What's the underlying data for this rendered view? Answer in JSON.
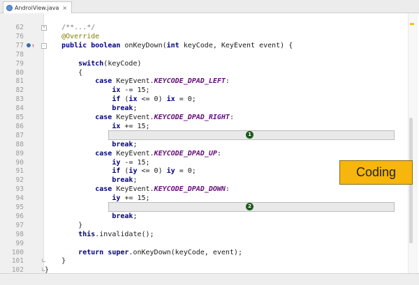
{
  "tab": {
    "title": "AndroiView.java",
    "close": "×"
  },
  "overlay": {
    "label": "Coding"
  },
  "badges": [
    "1",
    "2"
  ],
  "lines": [
    {
      "n": "62",
      "segs": [
        [
          "",
          "    "
        ],
        [
          "cmt",
          "/**...*/"
        ]
      ]
    },
    {
      "n": "76",
      "segs": [
        [
          "",
          "    "
        ],
        [
          "ann",
          "@Override"
        ]
      ]
    },
    {
      "n": "77",
      "segs": [
        [
          "",
          "    "
        ],
        [
          "kw",
          "public boolean"
        ],
        [
          "",
          " onKeyDown("
        ],
        [
          "kw",
          "int"
        ],
        [
          "",
          " keyCode, KeyEvent event) {"
        ]
      ]
    },
    {
      "n": "78",
      "segs": []
    },
    {
      "n": "79",
      "segs": [
        [
          "",
          "        "
        ],
        [
          "kw",
          "switch"
        ],
        [
          "",
          "(keyCode)"
        ]
      ]
    },
    {
      "n": "80",
      "segs": [
        [
          "",
          "        {"
        ]
      ]
    },
    {
      "n": "81",
      "segs": [
        [
          "",
          "            "
        ],
        [
          "kw",
          "case"
        ],
        [
          "",
          " KeyEvent."
        ],
        [
          "const",
          "KEYCODE_DPAD_LEFT"
        ],
        [
          "",
          ":"
        ]
      ]
    },
    {
      "n": "82",
      "segs": [
        [
          "",
          "                "
        ],
        [
          "kw",
          "ix"
        ],
        [
          "",
          " -= 15;"
        ]
      ]
    },
    {
      "n": "83",
      "segs": [
        [
          "",
          "                "
        ],
        [
          "kw",
          "if"
        ],
        [
          "",
          " ("
        ],
        [
          "kw",
          "ix"
        ],
        [
          "",
          " <= 0) "
        ],
        [
          "kw",
          "ix"
        ],
        [
          "",
          " = 0;"
        ]
      ]
    },
    {
      "n": "84",
      "segs": [
        [
          "",
          "                "
        ],
        [
          "kw",
          "break"
        ],
        [
          "",
          ";"
        ]
      ]
    },
    {
      "n": "85",
      "segs": [
        [
          "",
          "            "
        ],
        [
          "kw",
          "case"
        ],
        [
          "",
          " KeyEvent."
        ],
        [
          "const",
          "KEYCODE_DPAD_RIGHT"
        ],
        [
          "",
          ":"
        ]
      ]
    },
    {
      "n": "86",
      "segs": [
        [
          "",
          "                "
        ],
        [
          "kw",
          "ix"
        ],
        [
          "",
          " += 15;"
        ]
      ]
    },
    {
      "n": "87",
      "segs": []
    },
    {
      "n": "88",
      "segs": [
        [
          "",
          "                "
        ],
        [
          "kw",
          "break"
        ],
        [
          "",
          ";"
        ]
      ]
    },
    {
      "n": "89",
      "segs": [
        [
          "",
          "            "
        ],
        [
          "kw",
          "case"
        ],
        [
          "",
          " KeyEvent."
        ],
        [
          "const",
          "KEYCODE_DPAD_UP"
        ],
        [
          "",
          ":"
        ]
      ]
    },
    {
      "n": "90",
      "segs": [
        [
          "",
          "                "
        ],
        [
          "kw",
          "iy"
        ],
        [
          "",
          " -= 15;"
        ]
      ]
    },
    {
      "n": "91",
      "segs": [
        [
          "",
          "                "
        ],
        [
          "kw",
          "if"
        ],
        [
          "",
          " ("
        ],
        [
          "kw",
          "iy"
        ],
        [
          "",
          " <= 0) "
        ],
        [
          "kw",
          "iy"
        ],
        [
          "",
          " = 0;"
        ]
      ]
    },
    {
      "n": "92",
      "segs": [
        [
          "",
          "                "
        ],
        [
          "kw",
          "break"
        ],
        [
          "",
          ";"
        ]
      ]
    },
    {
      "n": "93",
      "segs": [
        [
          "",
          "            "
        ],
        [
          "kw",
          "case"
        ],
        [
          "",
          " KeyEvent."
        ],
        [
          "const",
          "KEYCODE_DPAD_DOWN"
        ],
        [
          "",
          ":"
        ]
      ]
    },
    {
      "n": "94",
      "segs": [
        [
          "",
          "                "
        ],
        [
          "kw",
          "iy"
        ],
        [
          "",
          " += 15;"
        ]
      ]
    },
    {
      "n": "95",
      "segs": []
    },
    {
      "n": "96",
      "segs": [
        [
          "",
          "                "
        ],
        [
          "kw",
          "break"
        ],
        [
          "",
          ";"
        ]
      ]
    },
    {
      "n": "97",
      "segs": [
        [
          "",
          "        }"
        ]
      ]
    },
    {
      "n": "98",
      "segs": [
        [
          "",
          "        "
        ],
        [
          "kw",
          "this"
        ],
        [
          "",
          ".invalidate();"
        ]
      ]
    },
    {
      "n": "99",
      "segs": []
    },
    {
      "n": "100",
      "segs": [
        [
          "",
          "        "
        ],
        [
          "kw",
          "return super"
        ],
        [
          "",
          ".onKeyDown(keyCode, event);"
        ]
      ]
    },
    {
      "n": "101",
      "segs": [
        [
          "",
          "    }"
        ]
      ]
    },
    {
      "n": "102",
      "segs": [
        [
          "",
          "}"
        ]
      ]
    }
  ]
}
